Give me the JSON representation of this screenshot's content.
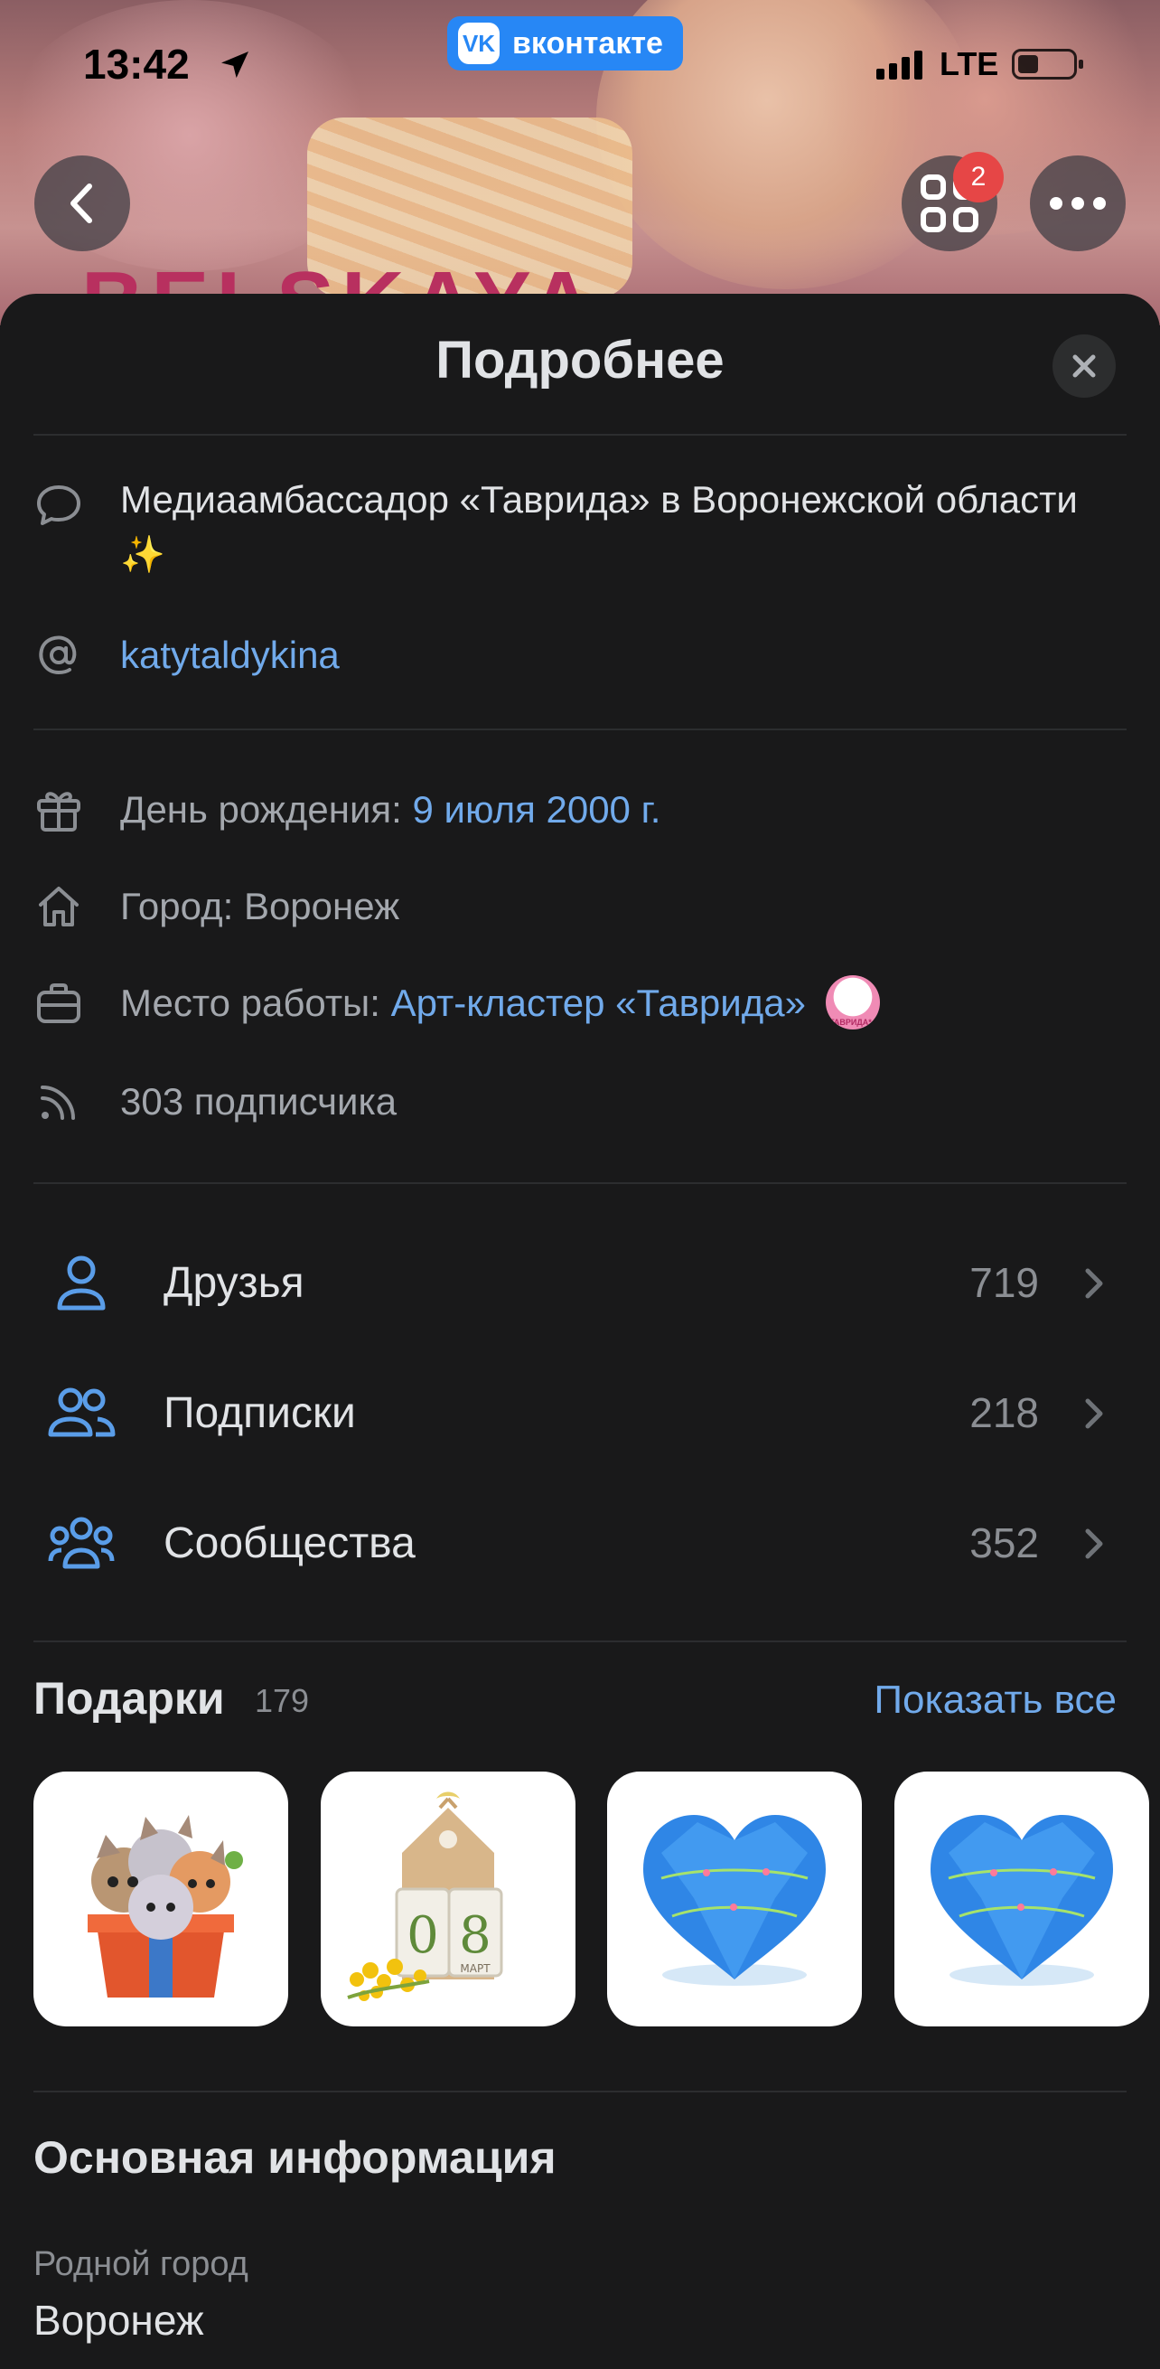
{
  "status_bar": {
    "time": "13:42",
    "network": "LTE"
  },
  "app_pill": {
    "logo": "VK",
    "label": "вконтакте"
  },
  "header": {
    "cover_text": "BELSKAYA",
    "apps_badge": "2"
  },
  "sheet": {
    "title": "Подробнее"
  },
  "about": {
    "status": "Медиаамбассадор «Таврида» в Воронежской области",
    "status_emoji": "✨",
    "nickname": "katytaldykina"
  },
  "details": {
    "birthday_label": "День рождения: ",
    "birthday_value": "9 июля 2000 г.",
    "city_label": "Город: ",
    "city_value": "Воронеж",
    "work_label": "Место работы: ",
    "work_value": "Арт-кластер «Таврида»",
    "work_avatar_text": "ТАВРИДА*АРТ",
    "followers": "303 подписчика"
  },
  "counters": [
    {
      "label": "Друзья",
      "count": "719",
      "icon": "user-icon"
    },
    {
      "label": "Подписки",
      "count": "218",
      "icon": "users-icon"
    },
    {
      "label": "Сообщества",
      "count": "352",
      "icon": "community-icon"
    }
  ],
  "gifts": {
    "title": "Подарки",
    "count": "179",
    "show_all": "Показать все",
    "items": [
      "cats-gift-box",
      "march-8-calendar",
      "blue-heart",
      "blue-heart"
    ],
    "calendar_digits": [
      "0",
      "8"
    ],
    "calendar_month": "МАРТ"
  },
  "basic_info": {
    "title": "Основная информация",
    "hometown_label": "Родной город",
    "hometown_value": "Воронеж"
  },
  "colors": {
    "background": "#19191a",
    "accent_link": "#71aaeb",
    "icon_blue": "#5a9de8",
    "vk_blue": "#2787f5"
  }
}
